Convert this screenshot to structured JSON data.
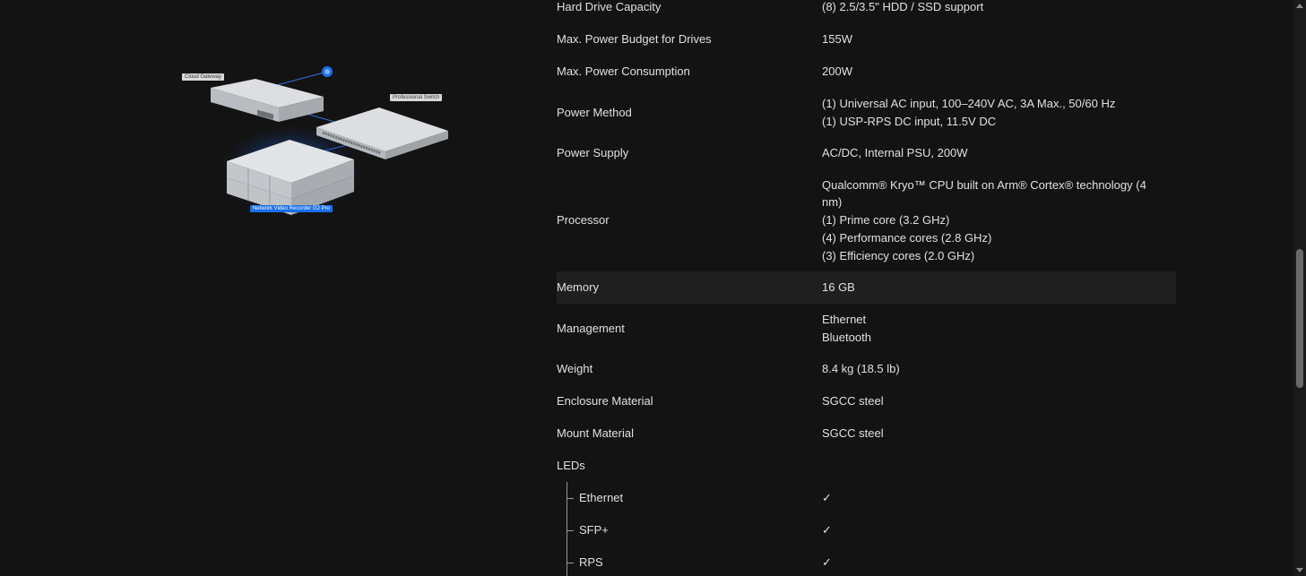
{
  "illustration": {
    "tags": {
      "cloud_gateway": "Cloud Gateway",
      "professional_switch": "Professional Switch",
      "nvr": "Network Video Recorder G2 Pro"
    },
    "colors": {
      "accent": "#1a6ee8",
      "device": "#cfd2d6"
    }
  },
  "specs": [
    {
      "label": "Hard Drive Capacity",
      "value": [
        "(8) 2.5/3.5\" HDD / SSD support"
      ]
    },
    {
      "label": "Max. Power Budget for Drives",
      "value": [
        "155W"
      ]
    },
    {
      "label": "Max. Power Consumption",
      "value": [
        "200W"
      ]
    },
    {
      "label": "Power Method",
      "value": [
        "(1) Universal AC input, 100–240V AC, 3A Max., 50/60 Hz",
        "(1) USP-RPS DC input, 11.5V DC"
      ]
    },
    {
      "label": "Power Supply",
      "value": [
        "AC/DC, Internal PSU, 200W"
      ]
    },
    {
      "label": "Processor",
      "value": [
        "Qualcomm® Kryo™ CPU built on Arm® Cortex® technology (4",
        "nm)",
        "(1) Prime core (3.2 GHz)",
        "(4) Performance cores (2.8 GHz)",
        "(3) Efficiency cores (2.0 GHz)"
      ]
    },
    {
      "label": "Memory",
      "value": [
        "16 GB"
      ]
    },
    {
      "label": "Management",
      "value": [
        "Ethernet",
        "Bluetooth"
      ]
    },
    {
      "label": "Weight",
      "value": [
        "8.4 kg (18.5 lb)"
      ]
    },
    {
      "label": "Enclosure Material",
      "value": [
        "SGCC steel"
      ]
    },
    {
      "label": "Mount Material",
      "value": [
        "SGCC steel"
      ]
    },
    {
      "label": "LEDs",
      "value": [
        ""
      ]
    }
  ],
  "leds": [
    {
      "label": "Ethernet",
      "value": "✓"
    },
    {
      "label": "SFP+",
      "value": "✓"
    },
    {
      "label": "RPS",
      "value": "✓"
    }
  ]
}
